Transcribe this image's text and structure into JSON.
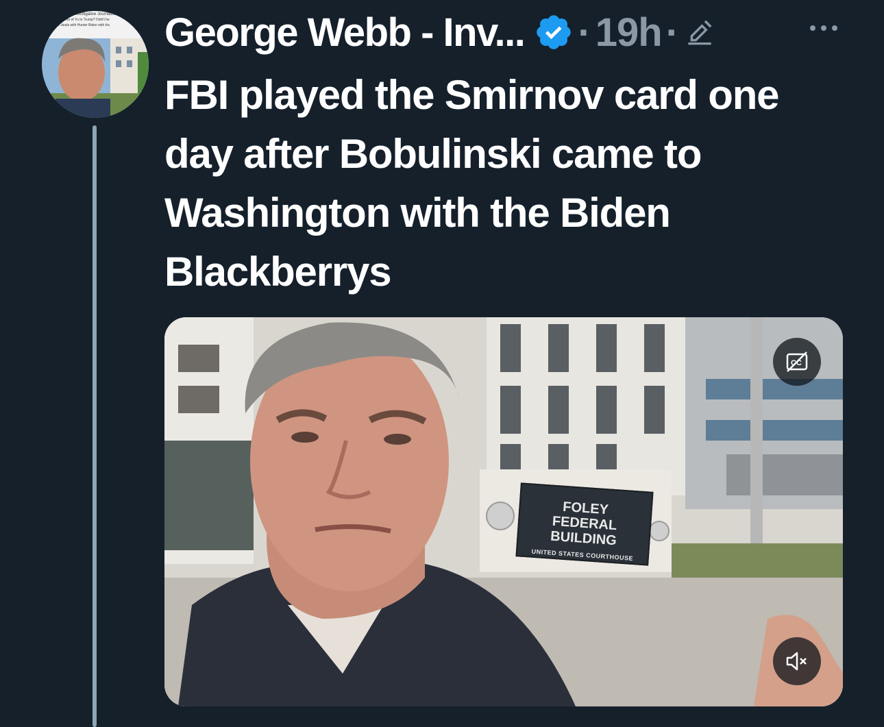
{
  "tweet": {
    "author_name": "George Webb - Inv...",
    "verified": true,
    "separator": "·",
    "timestamp": "19h",
    "edited": true,
    "text": "FBI played the Smirnov card one day after Bobulinski came to Washington with the Biden Blackberrys"
  },
  "avatar": {
    "thumbnail_text": [
      "Investigative Journalist",
      "...me of Yu to Trump? Didn't he",
      "...deals with Hunter Biden with his"
    ]
  },
  "media": {
    "type": "video",
    "sign_lines": [
      "FOLEY",
      "FEDERAL BUILDING",
      "UNITED STATES COURTHOUSE"
    ],
    "captions_button_icon": "captions-off-icon",
    "mute_button_icon": "volume-muted-icon"
  },
  "icons": {
    "verified": "verified-badge-icon",
    "edit": "edit-pencil-icon",
    "more": "more-options-icon"
  },
  "colors": {
    "background": "#15202b",
    "verified_blue": "#1d9bf0",
    "secondary_text": "#8b98a5"
  }
}
